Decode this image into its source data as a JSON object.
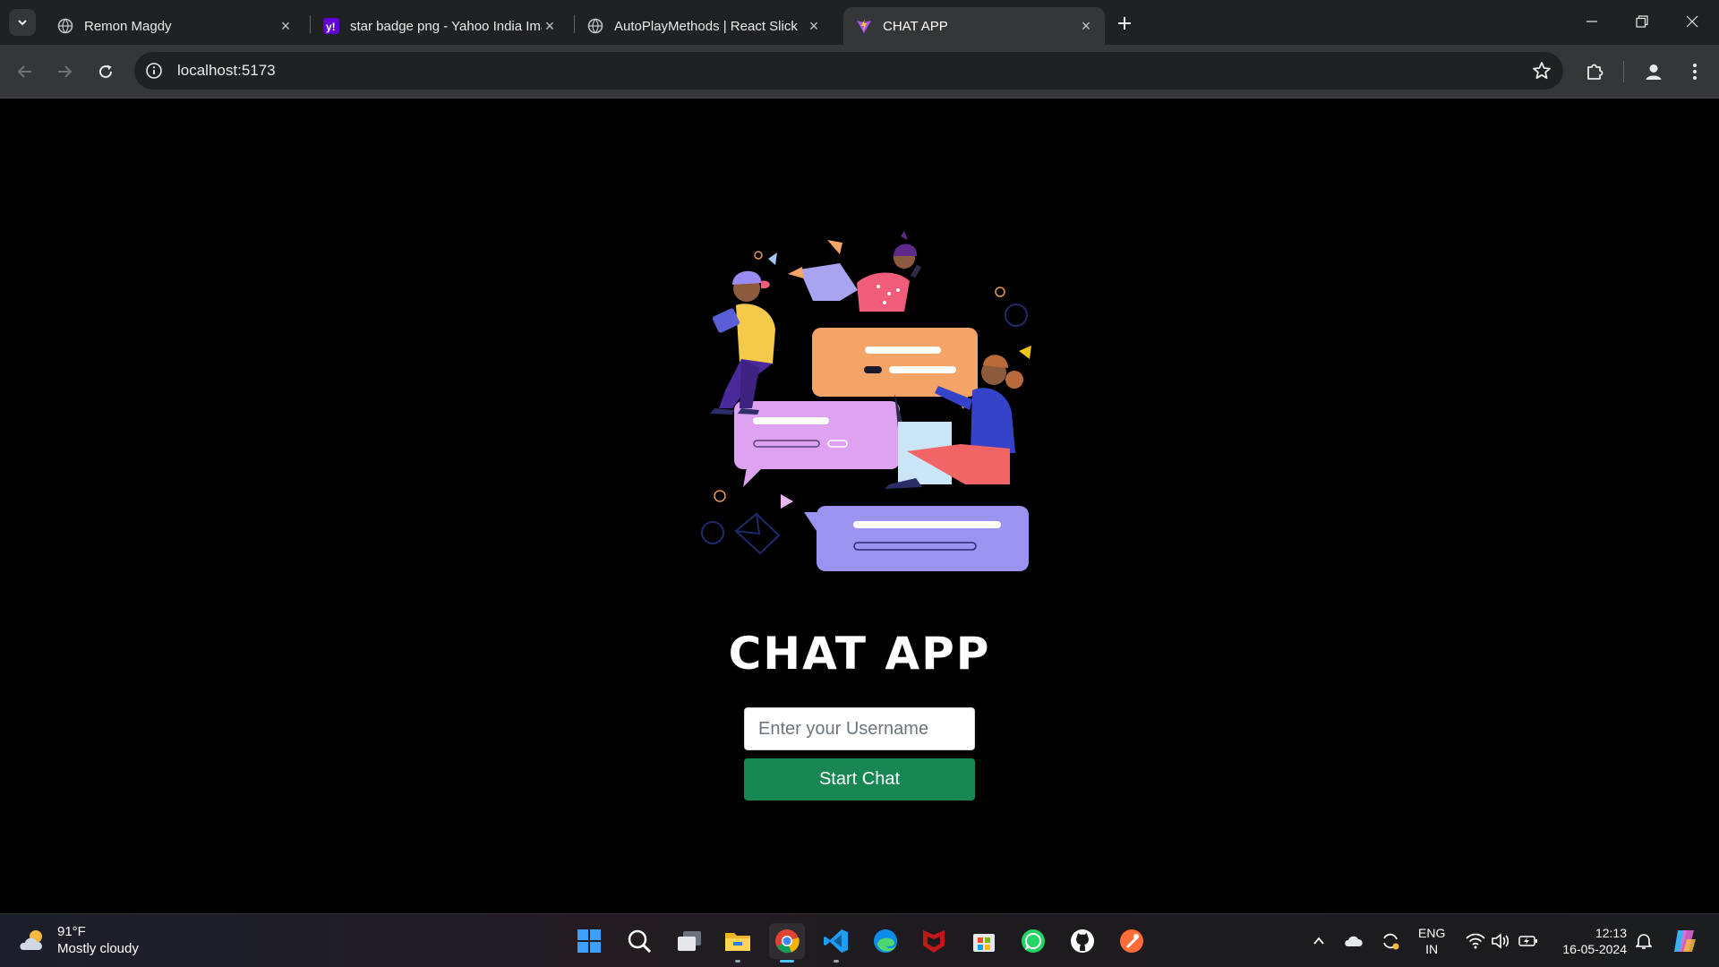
{
  "browser": {
    "tabs": [
      {
        "title": "Remon Magdy",
        "icon": "globe-icon",
        "active": false
      },
      {
        "title": "star badge png - Yahoo India Ima",
        "icon": "yahoo-icon",
        "active": false
      },
      {
        "title": "AutoPlayMethods | React Slick",
        "icon": "globe-icon",
        "active": false
      },
      {
        "title": "CHAT APP",
        "icon": "vite-icon",
        "active": true
      }
    ],
    "url": "localhost:5173"
  },
  "page": {
    "title": "CHAT APP",
    "username_placeholder": "Enter your Username",
    "username_value": "",
    "start_button": "Start Chat"
  },
  "taskbar": {
    "weather": {
      "temp": "91°F",
      "condition": "Mostly cloudy"
    },
    "apps": [
      "start-icon",
      "search-icon",
      "task-view-icon",
      "file-explorer-icon",
      "chrome-icon",
      "vscode-icon",
      "edge-icon",
      "mcafee-icon",
      "microsoft-store-icon",
      "whatsapp-icon",
      "github-icon",
      "postman-icon"
    ],
    "language": {
      "line1": "ENG",
      "line2": "IN"
    },
    "time": "12:13",
    "date": "16-05-2024"
  },
  "colors": {
    "start_button": "#198754",
    "page_bg": "#000000",
    "browser_chrome": "#35363a"
  }
}
